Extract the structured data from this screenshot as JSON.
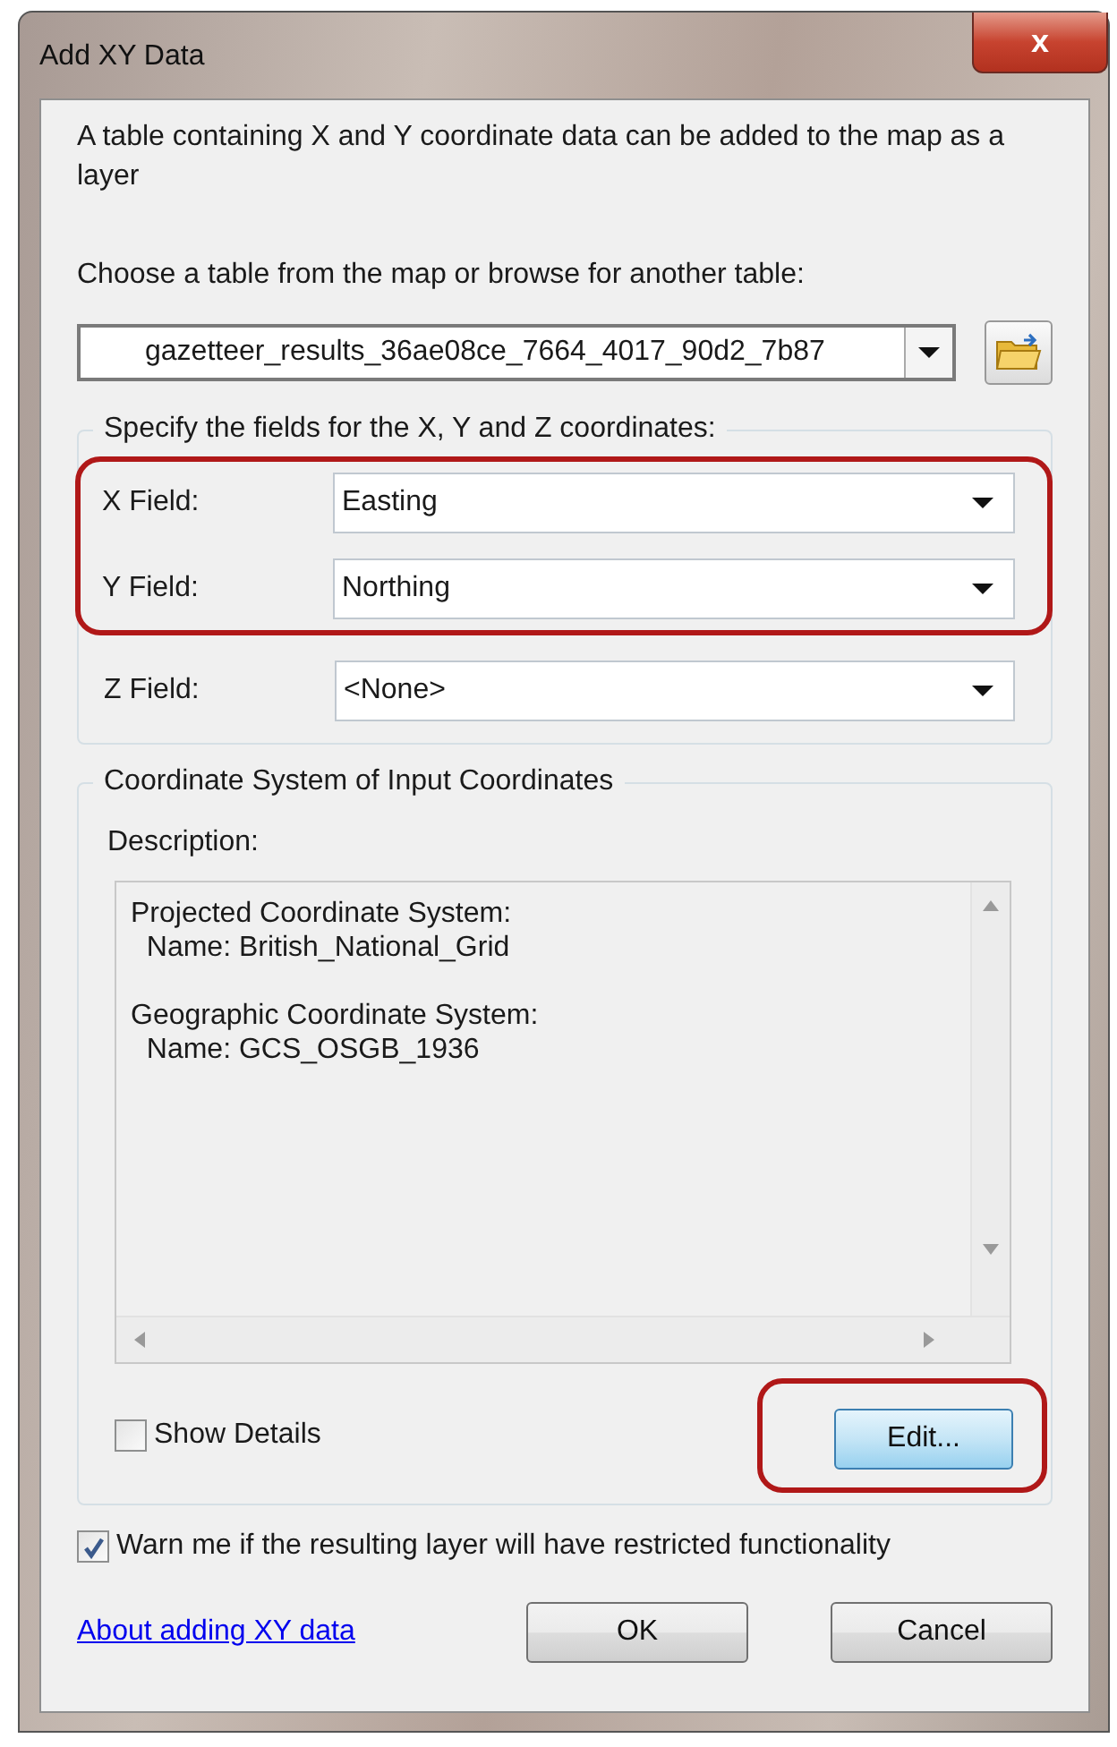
{
  "window": {
    "title": "Add XY Data",
    "close_label": "x"
  },
  "intro": "A table containing X and Y coordinate data can be added to the map as a layer",
  "table_prompt": "Choose a table from the map or browse for another table:",
  "table_value": "gazetteer_results_36ae08ce_7664_4017_90d2_7b87",
  "coordinate_fields": {
    "title": "Specify the fields for the X, Y and Z coordinates:",
    "rows": [
      {
        "label": "X Field:",
        "value": "Easting",
        "highlighted": true
      },
      {
        "label": "Y Field:",
        "value": "Northing",
        "highlighted": true
      },
      {
        "label": "Z Field:",
        "value": "<None>",
        "highlighted": false
      }
    ]
  },
  "coordinate_system": {
    "title": "Coordinate System of Input Coordinates",
    "description_label": "Description:",
    "description_blocks": [
      [
        "Projected Coordinate System:",
        "  Name: British_National_Grid"
      ],
      [
        "Geographic Coordinate System:",
        "  Name: GCS_OSGB_1936"
      ]
    ],
    "show_details": {
      "label": "Show Details",
      "checked": false
    },
    "edit_button": {
      "label": "Edit...",
      "highlighted": true
    }
  },
  "warn": {
    "label": "Warn me if the resulting layer will have restricted functionality",
    "checked": true
  },
  "help_link": "About adding XY data",
  "buttons": [
    "OK",
    "Cancel"
  ]
}
